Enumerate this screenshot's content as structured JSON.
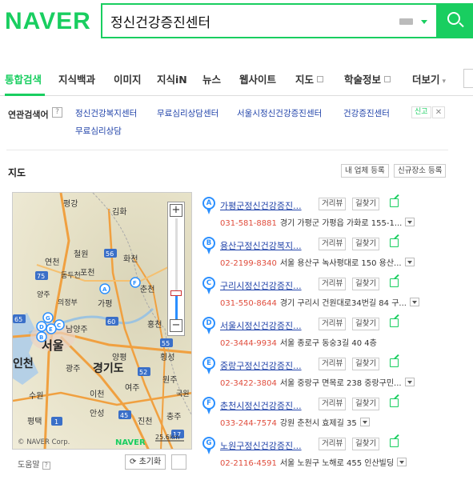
{
  "logo": "NAVER",
  "search": {
    "query": "정신건강증진센터"
  },
  "tabs": [
    {
      "label": "통합검색"
    },
    {
      "label": "지식백과"
    },
    {
      "label": "이미지"
    },
    {
      "label": "지식iN"
    },
    {
      "label": "뉴스"
    },
    {
      "label": "웹사이트"
    },
    {
      "label": "지도"
    },
    {
      "label": "학술정보"
    },
    {
      "label": "더보기"
    }
  ],
  "related": {
    "label": "연관검색어",
    "help": "?",
    "links": [
      "정신건강복지센터",
      "무료심리상담센터",
      "서울시정신건강증진센터",
      "건강증진센터",
      "무료심리상담"
    ],
    "report": "신고",
    "close": "✕"
  },
  "map_section": {
    "title": "지도",
    "register_mine": "내 업체 등록",
    "register_new": "신규장소 등록",
    "labels": [
      "평강",
      "김화",
      "연천",
      "철원",
      "화천",
      "춘천",
      "포천",
      "가평",
      "동두천",
      "양주",
      "의정부",
      "남양주",
      "홍천",
      "서울",
      "인천",
      "광주",
      "경기도",
      "양평",
      "횡성",
      "원주",
      "여주",
      "수원",
      "이천",
      "국원",
      "안성",
      "평택",
      "진천",
      "충주"
    ],
    "route_numbers": [
      "56",
      "75",
      "65",
      "60",
      "55",
      "52",
      "1",
      "45",
      "17"
    ],
    "copyright": "© NAVER Corp.",
    "map_logo": "NAVER",
    "scale": "25.6km",
    "zoom_in": "+",
    "zoom_out": "−",
    "help": "도움말",
    "help_q": "?",
    "reset": "초기화"
  },
  "results": [
    {
      "letter": "A",
      "name": "가평군정신건강증진...",
      "phone": "031-581-8881",
      "address": "경기 가평군 가평읍 가화로 155-1..."
    },
    {
      "letter": "B",
      "name": "용산구정신건강복지...",
      "phone": "02-2199-8340",
      "address": "서울 용산구 녹사평대로 150 용산..."
    },
    {
      "letter": "C",
      "name": "구리시정신건강증진...",
      "phone": "031-550-8644",
      "address": "경기 구리시 건원대로34번길 84 구..."
    },
    {
      "letter": "D",
      "name": "서울시정신건강증진...",
      "phone": "02-3444-9934",
      "address": "서울 종로구 동숭3길 40 4층"
    },
    {
      "letter": "E",
      "name": "중랑구정신건강증진...",
      "phone": "02-3422-3804",
      "address": "서울 중랑구 면목로 238 중랑구민..."
    },
    {
      "letter": "F",
      "name": "춘천시정신건강증진...",
      "phone": "033-244-7574",
      "address": "강원 춘천시 효제길 35"
    },
    {
      "letter": "G",
      "name": "노원구정신건강증진...",
      "phone": "02-2116-4591",
      "address": "서울 노원구 노해로 455 인산빌딩"
    }
  ],
  "result_buttons": {
    "review": "거리뷰",
    "directions": "길찾기"
  }
}
